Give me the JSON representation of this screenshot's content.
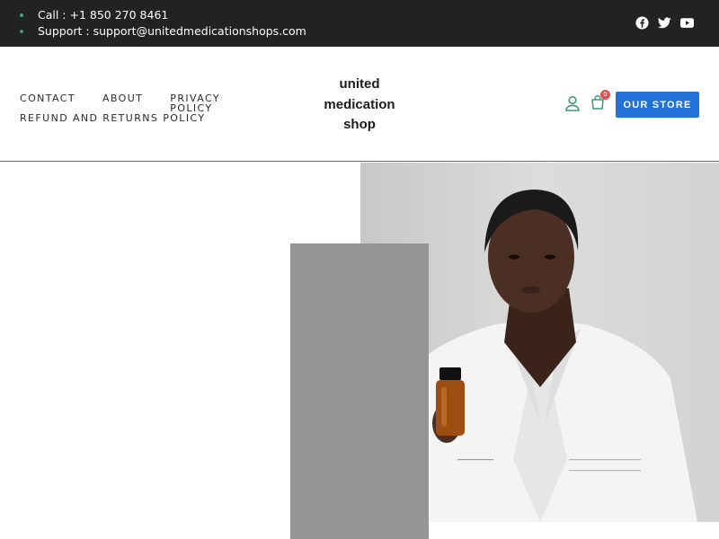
{
  "topbar": {
    "call": "Call : +1 850 270 8461",
    "support": "Support : support@unitedmedicationshops.com",
    "socials": [
      "facebook-icon",
      "twitter-icon",
      "youtube-icon"
    ]
  },
  "nav": {
    "items": [
      "CONTACT",
      "ABOUT",
      "PRIVACY POLICY",
      "REFUND AND RETURNS POLICY"
    ]
  },
  "logo": {
    "line1": "united",
    "line2": "medication",
    "line3": "shop"
  },
  "cart": {
    "count": "0"
  },
  "store_button": "OUR STORE",
  "colors": {
    "topbar": "#222222",
    "accent_blue": "#2271d8",
    "icon_green": "#3d9a78",
    "badge_red": "#e05050"
  },
  "hero": {
    "photo": "woman in white lab coat holding amber medicine bottle"
  }
}
